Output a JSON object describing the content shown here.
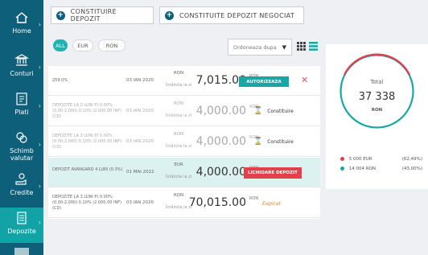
{
  "sidebar": {
    "items": [
      {
        "label": "Home",
        "icon": "home-icon"
      },
      {
        "label": "Conturi",
        "icon": "bank-icon"
      },
      {
        "label": "Plati",
        "icon": "payments-icon"
      },
      {
        "label": "Schimb valutar",
        "icon": "exchange-icon"
      },
      {
        "label": "Credite",
        "icon": "credit-icon"
      },
      {
        "label": "Depozite",
        "icon": "deposit-icon"
      }
    ]
  },
  "actions": {
    "new_deposit": "CONSTITUIRE DEPOZIT",
    "new_negotiated": "CONSTITUITE DEPOZIT NEGOCIAT"
  },
  "filters": {
    "all": "ALL",
    "eur": "EUR",
    "ron": "RON"
  },
  "sort": {
    "placeholder": "Ordoneaza dupa"
  },
  "deposits": [
    {
      "name": "259.0%",
      "date": "03 IAN 2020",
      "currency": "RON",
      "sub": "Întâlnita la zi",
      "amount": "7,015.00",
      "amount_currency": "RON",
      "action": "AUTORIZEAZA"
    },
    {
      "name": "DEPOZITE LA 3 LUNI P) 0.00% (0.00-2.000) 0.10% (2.000.00 INF) (CD)",
      "date": "03 IAN 2020",
      "currency": "RON",
      "sub": "Întâlnita la zi",
      "amount": "4,000.00",
      "amount_currency": "RON",
      "status": "Constituire"
    },
    {
      "name": "DEPOZITE LA 3 LUNI P) 0.00% (0.00-2.000) 0.10% (2.000.00 INF) (CD)",
      "date": "03 IAN 2020",
      "currency": "RON",
      "sub": "Întâlnita la zi",
      "amount": "4,000.00",
      "amount_currency": "RON",
      "status": "Constituire"
    },
    {
      "name": "DEPOZIT AVANGARD 4 LUNI (0.3%)",
      "date": "01 MAI 2022",
      "currency": "EUR",
      "sub": "Întâlnita la zi",
      "amount": "4,000.00",
      "amount_currency": "RON",
      "action": "LICHIDARE DEPOZIT"
    },
    {
      "name": "DEPOZITE LA 3 LUNI P) 0.00% (0.00-2.000) 0.10% (2.000.00 INF) (CD)",
      "date": "03 IAN 2020",
      "currency": "RON",
      "sub": "Întâlnita la zi",
      "amount": "70,015.00",
      "amount_currency": "RON",
      "status": "Expirat"
    }
  ],
  "summary": {
    "label": "Total",
    "value": "37 338",
    "currency": "RON",
    "legend": [
      {
        "label": "5 000 EUR",
        "pct": "(62,49%)",
        "color": "#e2404a"
      },
      {
        "label": "14 004 RON",
        "pct": "(43,00%)",
        "color": "#1aa6a5"
      }
    ]
  },
  "colors": {
    "sidebar": "#0d5f7a",
    "accent": "#1aa6a5",
    "danger": "#e2404a",
    "expired": "#e38b2c"
  }
}
